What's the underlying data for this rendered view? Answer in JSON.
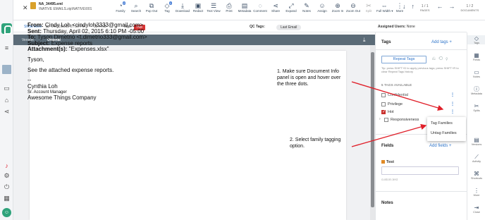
{
  "header": {
    "file_name": "NA_34495.eml",
    "file_path": "\\NATIVE EMAILS.zip\\NATIVE\\001",
    "tools": [
      {
        "label": "Family",
        "icon": "family-icon",
        "glyph": "◔",
        "badge": "2"
      },
      {
        "label": "Search",
        "icon": "search-icon",
        "glyph": "⌕"
      },
      {
        "label": "Pop Out",
        "icon": "pop-out-icon",
        "glyph": "⧉"
      },
      {
        "label": "Tag",
        "icon": "tag-icon",
        "glyph": "◇",
        "badge": "1"
      },
      {
        "label": "Download",
        "icon": "download-icon",
        "glyph": "⤓"
      },
      {
        "label": "Redact",
        "icon": "redact-icon",
        "glyph": "▣"
      },
      {
        "label": "Text View",
        "icon": "text-view-icon",
        "glyph": "☰"
      },
      {
        "label": "Print",
        "icon": "print-icon",
        "glyph": "⎙"
      },
      {
        "label": "Metadata",
        "icon": "metadata-icon",
        "glyph": "▤"
      },
      {
        "label": "Comment",
        "icon": "comment-icon",
        "glyph": "◌"
      },
      {
        "label": "Share",
        "icon": "share-icon",
        "glyph": "⋖"
      },
      {
        "label": "Expand",
        "icon": "expand-icon",
        "glyph": "⤢"
      },
      {
        "label": "Notes",
        "icon": "notes-icon",
        "glyph": "✎"
      },
      {
        "label": "Assign",
        "icon": "assign-icon",
        "glyph": "☺"
      },
      {
        "label": "Zoom In",
        "icon": "zoom-in-icon",
        "glyph": "⊕"
      },
      {
        "label": "Zoom Out",
        "icon": "zoom-out-icon",
        "glyph": "⊖"
      },
      {
        "label": "Split",
        "icon": "split-icon",
        "glyph": "✂",
        "disabled": true
      },
      {
        "label": "Full Width ▾",
        "icon": "full-width-icon",
        "glyph": "⇔"
      },
      {
        "label": "More",
        "icon": "more-icon",
        "glyph": "⋮"
      }
    ],
    "pages_label": "PAGES",
    "pages_count": "1 / 1",
    "documents_label": "DOCUMENTS",
    "documents_count": "1 / 2"
  },
  "subbar": {
    "show_more": "Show More",
    "date": "04/02/2015 07:10 PM",
    "size": "15.4 KB",
    "tags_label": "Tags:",
    "tag_value": "Hot",
    "qc_label": "QC Tags:",
    "qc_value": "Last Email",
    "assigned_label": "Assigned Users:",
    "assigned_value": "None"
  },
  "version_bar": {
    "version_label": "Version",
    "version_value": "Original"
  },
  "email": {
    "from_label": "From:",
    "from_value": " Cindy Loh <cindyloh3333@gmail.com>",
    "sent_label": "Sent:",
    "sent_value": " Thursday, April 02, 2015 6:10 PM -05:00",
    "to_label": "To:",
    "to_value": " Tyson Dimetrio <t.dimetrio333@gmail.com>",
    "subject_label": "Subject:",
    "subject_value": " Expense reports",
    "attachment_label": "Attachment(s):",
    "attachment_value": " \"Expenses.xlsx\"",
    "greeting": "Tyson,",
    "body": "See the attached expense reports.",
    "sep": "--",
    "sig_name": "Cynthia Loh",
    "sig_title": "Sr. Account Manager",
    "sig_company": "Awesome Things Company"
  },
  "annotations": {
    "note1_line1": "1. Make sure Document Info",
    "note1_line2": "panel is open and hover over",
    "note1_line3": "the three dots.",
    "note2_line1": "2. Select family tagging",
    "note2_line2": "option."
  },
  "tags_panel": {
    "title": "Tags",
    "add_tags": "Add tags +",
    "repeat_tags": "Repeat Tags",
    "hint": "Tip: press SHIFT+D to apply previous tags; press SHIFT+R to clear Repeat Tags history",
    "available_label": "5 TAGS AVAILABLE",
    "tags": [
      {
        "label": "Confidential",
        "checked": false
      },
      {
        "label": "Privilege",
        "checked": false
      },
      {
        "label": "Hot",
        "checked": true
      },
      {
        "label": "Responsiveness",
        "checked": false
      }
    ],
    "menu": [
      "Tag Families",
      "Untag Families"
    ],
    "fields_title": "Fields",
    "add_fields": "Add fields +",
    "field_name": "Test",
    "field_placeholder": "custom.test",
    "notes_title": "Notes"
  },
  "rail": [
    {
      "label": "Tags",
      "icon": "tags-icon",
      "glyph": "◇"
    },
    {
      "label": "Fields",
      "icon": "fields-icon",
      "glyph": "▦"
    },
    {
      "label": "Notes",
      "icon": "notes-icon",
      "glyph": "▭"
    },
    {
      "label": "Metadata",
      "icon": "metadata-icon",
      "glyph": "ⓘ"
    },
    {
      "label": "Splits",
      "icon": "splits-icon",
      "glyph": "✂"
    },
    {
      "label": "",
      "icon": "blank-icon",
      "glyph": ""
    },
    {
      "label": "Versions",
      "icon": "versions-icon",
      "glyph": "▤"
    },
    {
      "label": "Activity",
      "icon": "activity-icon",
      "glyph": "⟋"
    },
    {
      "label": "Shortcuts",
      "icon": "shortcuts-icon",
      "glyph": "⌘"
    },
    {
      "label": "More",
      "icon": "more-icon",
      "glyph": "⋮"
    },
    {
      "label": "Close",
      "icon": "close-panel-icon",
      "glyph": "⇥"
    }
  ],
  "colors": {
    "accent": "#2e74c9",
    "brand": "#2fa37b",
    "hot_tag": "#d73535",
    "annotation_arrow": "#e0202a"
  }
}
